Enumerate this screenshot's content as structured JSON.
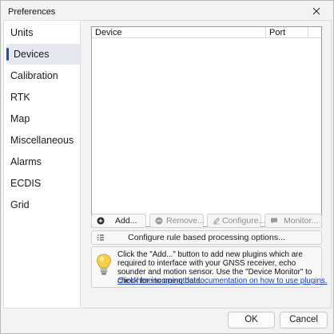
{
  "window": {
    "title": "Preferences"
  },
  "sidebar": {
    "items": [
      {
        "label": "Units",
        "active": false
      },
      {
        "label": "Devices",
        "active": true
      },
      {
        "label": "Calibration",
        "active": false
      },
      {
        "label": "RTK",
        "active": false
      },
      {
        "label": "Map",
        "active": false
      },
      {
        "label": "Miscellaneous",
        "active": false
      },
      {
        "label": "Alarms",
        "active": false
      },
      {
        "label": "ECDIS",
        "active": false
      },
      {
        "label": "Grid",
        "active": false
      }
    ]
  },
  "devices": {
    "columns": [
      "Device",
      "Port"
    ],
    "rows": [],
    "buttons": {
      "add": {
        "label": "Add...",
        "icon": "add-circle-icon",
        "enabled": true
      },
      "remove": {
        "label": "Remove...",
        "icon": "remove-circle-icon",
        "enabled": false
      },
      "configure": {
        "label": "Configure...",
        "icon": "pencil-icon",
        "enabled": false
      },
      "monitor": {
        "label": "Monitor...",
        "icon": "chat-bubble-icon",
        "enabled": false
      }
    },
    "configure_rules_label": "Configure rule based processing options...",
    "info": {
      "icon": "lightbulb-icon",
      "text": "Click the \"Add...\" button to add new plugins which are required to interface with your GNSS receiver, echo sounder and motion sensor. Use the \"Device Monitor\" to check for incoming data.",
      "link": "Click here to open the documentation on how to use plugins."
    }
  },
  "footer": {
    "ok_label": "OK",
    "cancel_label": "Cancel"
  },
  "colors": {
    "accent": "#2b4c8c",
    "link": "#1a3fb5",
    "selected_bg": "#e5e8ee"
  }
}
